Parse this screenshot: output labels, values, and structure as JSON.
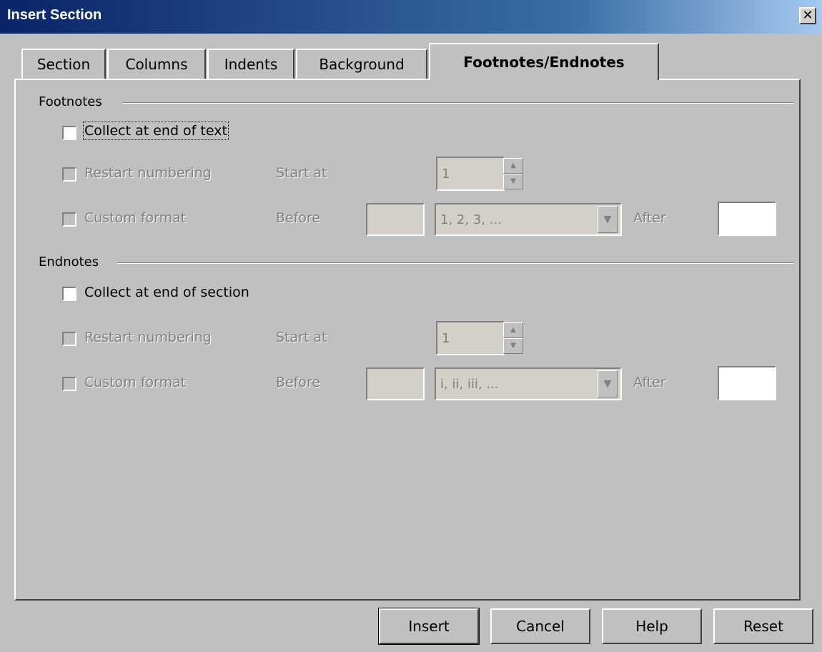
{
  "window": {
    "title": "Insert Section",
    "close_glyph": "✕"
  },
  "tabs": [
    {
      "label": "Section"
    },
    {
      "label": "Columns"
    },
    {
      "label": "Indents"
    },
    {
      "label": "Background"
    },
    {
      "label": "Footnotes/Endnotes",
      "active": true
    }
  ],
  "footnotes": {
    "group_label": "Footnotes",
    "collect_label": "Collect at end of text",
    "restart_label": "Restart numbering",
    "start_at_label": "Start at",
    "start_at_value": "1",
    "custom_label": "Custom format",
    "before_label": "Before",
    "format_value": "1, 2, 3, ...",
    "after_label": "After"
  },
  "endnotes": {
    "group_label": "Endnotes",
    "collect_label": "Collect at end of section",
    "restart_label": "Restart numbering",
    "start_at_label": "Start at",
    "start_at_value": "1",
    "custom_label": "Custom format",
    "before_label": "Before",
    "format_value": "i, ii, iii, ...",
    "after_label": "After"
  },
  "buttons": {
    "insert": "Insert",
    "cancel": "Cancel",
    "help": "Help",
    "reset": "Reset"
  }
}
